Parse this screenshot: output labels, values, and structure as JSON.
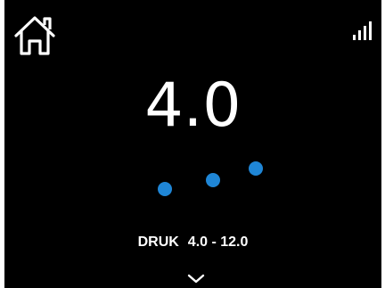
{
  "screen": {
    "background": "#000000"
  },
  "header": {
    "home_icon": "home-icon",
    "signal_icon": "signal-strength-icon",
    "signal_bars_total": 4,
    "signal_bars_active": 4
  },
  "reading": {
    "value": "4.0"
  },
  "indicator": {
    "dot_color": "#1f86d6",
    "dots_count": 3
  },
  "range": {
    "label": "DRUK",
    "values": "4.0 - 12.0"
  },
  "navigation": {
    "down_icon": "chevron-down-icon"
  }
}
